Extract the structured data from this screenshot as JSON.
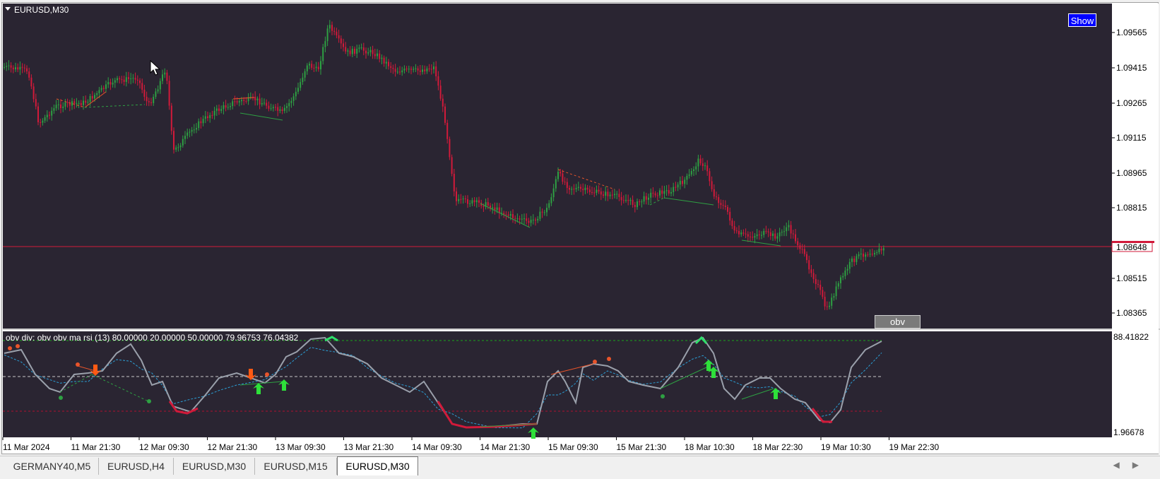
{
  "chart": {
    "symbol_label": "EURUSD,M30",
    "show_button": "Show",
    "obv_button": "obv",
    "current_price": "1.08648",
    "price_axis": [
      "1.09565",
      "1.09415",
      "1.09265",
      "1.09115",
      "1.08965",
      "1.08815",
      "1.08515",
      "1.08365"
    ],
    "colors": {
      "background": "#2a2532",
      "bull": "#2ea043",
      "bear": "#d11a3a",
      "price_line": "#d11a3a",
      "grid_text": "#000000"
    }
  },
  "indicator": {
    "label": "obv div: obv obv ma rsi (13) 80.00000 20.00000 50.00000 79.96753 76.04382",
    "axis_top": "88.41822",
    "axis_bottom": "1.96678"
  },
  "time_axis": [
    "11 Mar 2024",
    "11 Mar 21:30",
    "12 Mar 09:30",
    "12 Mar 21:30",
    "13 Mar 09:30",
    "13 Mar 21:30",
    "14 Mar 09:30",
    "14 Mar 21:30",
    "15 Mar 09:30",
    "15 Mar 21:30",
    "18 Mar 10:30",
    "18 Mar 22:30",
    "19 Mar 10:30",
    "19 Mar 22:30"
  ],
  "tabs": [
    {
      "label": "GERMANY40,M5",
      "active": false
    },
    {
      "label": "EURUSD,H4",
      "active": false
    },
    {
      "label": "EURUSD,M30",
      "active": false
    },
    {
      "label": "EURUSD,M15",
      "active": false
    },
    {
      "label": "EURUSD,M30",
      "active": true
    }
  ]
}
